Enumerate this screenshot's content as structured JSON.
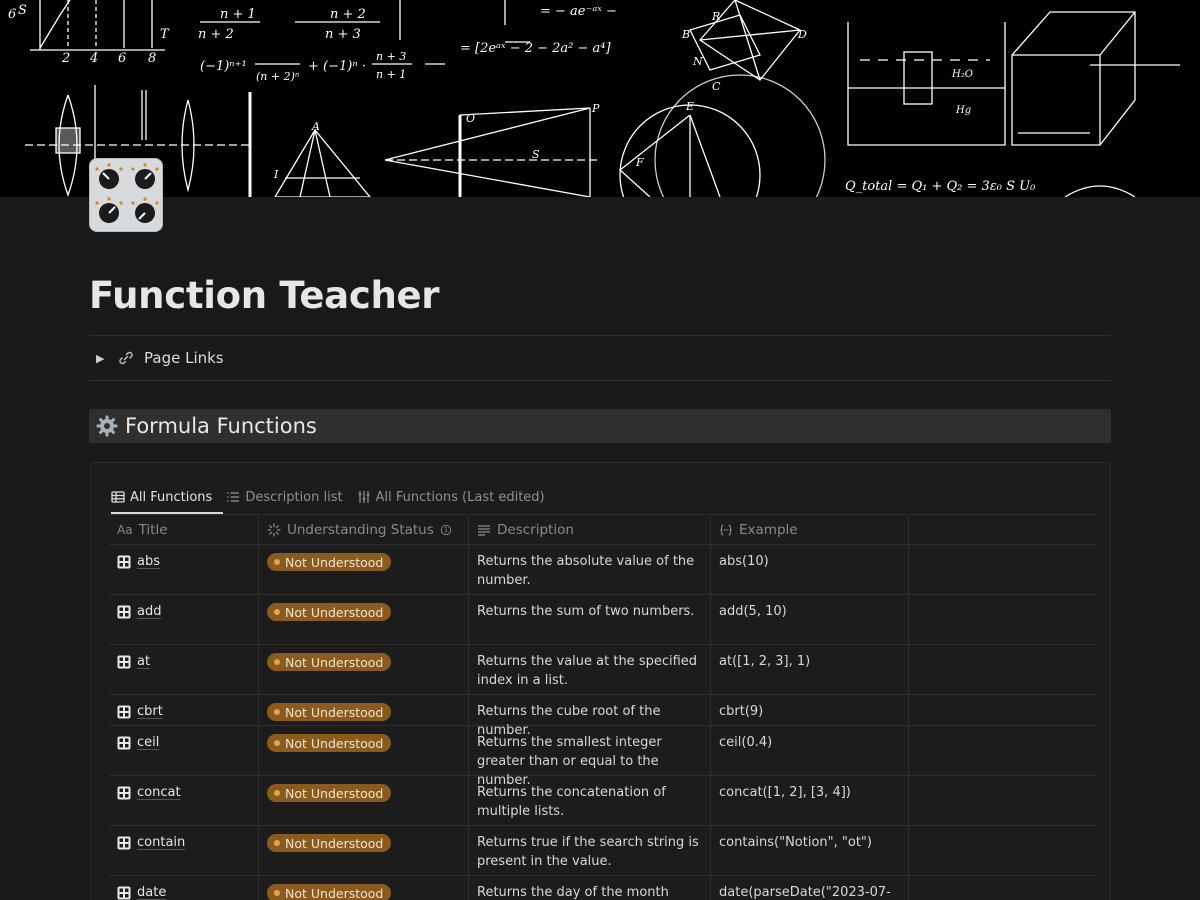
{
  "page": {
    "title": "Function Teacher",
    "toggle_label": "Page Links"
  },
  "cover": {
    "equations": {
      "frac_top_a": "n + 1",
      "frac_top_b": "n + 2",
      "t_term": "T",
      "n_plus_2": "n + 2",
      "n_plus_3": "n + 3",
      "series": "(−1)ⁿ⁺¹",
      "series_den": "(n + 2)ⁿ",
      "series_plus": "+ (−1)ⁿ ·",
      "series_frac": "n + 3",
      "series_frac_den": "n + 1",
      "integral": "= − ae⁻ᵃˣ − ",
      "integral2": "= [2eᵃˣ − 2 − 2a² − a⁴]",
      "q_total": "Q_total = Q₁ + Q₂ = 3ε₀ S U₀",
      "h2o": "H₂O",
      "hg": "Hg",
      "axis_nums": [
        "2",
        "4",
        "6",
        "8"
      ],
      "letters": [
        "A",
        "B",
        "C",
        "D",
        "E",
        "F",
        "N",
        "P",
        "R",
        "S",
        "I",
        "O"
      ]
    }
  },
  "section": {
    "heading": "Formula Functions"
  },
  "database": {
    "tabs": [
      {
        "label": "All Functions",
        "active": true
      },
      {
        "label": "Description list",
        "active": false
      },
      {
        "label": "All Functions (Last edited)",
        "active": false
      }
    ],
    "columns": [
      "Title",
      "Understanding Status",
      "Description",
      "Example"
    ],
    "rows": [
      {
        "title": "abs",
        "status": "Not Understood",
        "description": "Returns the absolute value of the number.",
        "example": "abs(10)"
      },
      {
        "title": "add",
        "status": "Not Understood",
        "description": "Returns the sum of two numbers.",
        "example": "add(5, 10)"
      },
      {
        "title": "at",
        "status": "Not Understood",
        "description": "Returns the value at the specified index in a list.",
        "example": "at([1, 2, 3], 1)"
      },
      {
        "title": "cbrt",
        "status": "Not Understood",
        "description": "Returns the cube root of the number.",
        "example": "cbrt(9)"
      },
      {
        "title": "ceil",
        "status": "Not Understood",
        "description": "Returns the smallest integer greater than or equal to the number.",
        "example": "ceil(0.4)"
      },
      {
        "title": "concat",
        "status": "Not Understood",
        "description": "Returns the concatenation of multiple lists.",
        "example": "concat([1, 2], [3, 4])"
      },
      {
        "title": "contain",
        "status": "Not Understood",
        "description": "Returns true if the search string is present in the value.",
        "example": "contains(\"Notion\", \"ot\")"
      },
      {
        "title": "date",
        "status": "Not Understood",
        "description": "Returns the day of the month from the",
        "example": "date(parseDate(\"2023-07-"
      }
    ],
    "colors": {
      "badge_bg": "#8a5a1e",
      "badge_dot": "#e2a34a"
    }
  }
}
